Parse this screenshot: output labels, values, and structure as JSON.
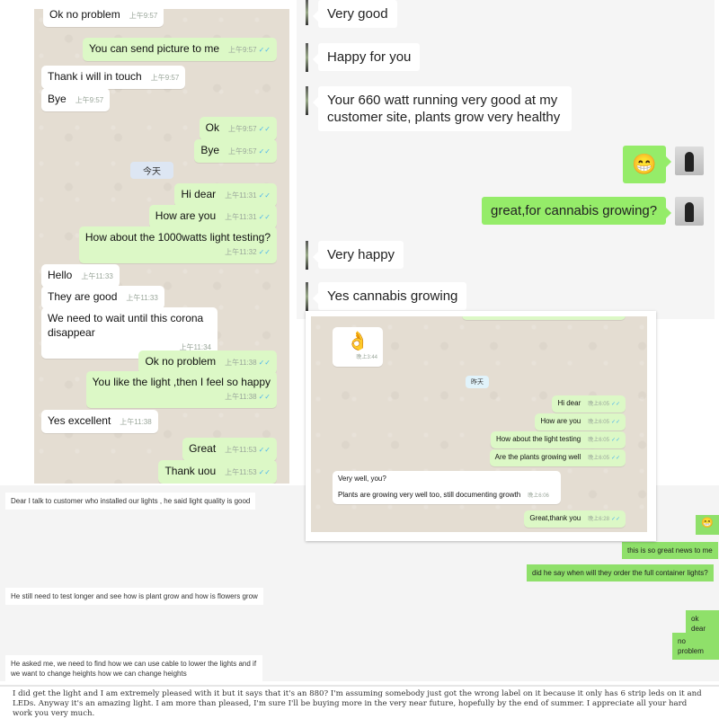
{
  "panel_whatsapp_phone": {
    "messages": [
      {
        "dir": "in",
        "text": "Ok no problem",
        "time": "上午9:57"
      },
      {
        "dir": "out",
        "text": "You can send picture to me",
        "time": "上午9:57"
      },
      {
        "dir": "in",
        "text": "Thank i will in touch",
        "time": "上午9:57"
      },
      {
        "dir": "in",
        "text": "Bye",
        "time": "上午9:57"
      },
      {
        "dir": "out",
        "text": "Ok",
        "time": "上午9:57"
      },
      {
        "dir": "out",
        "text": "Bye",
        "time": "上午9:57"
      },
      {
        "dir": "out",
        "text": "Hi dear",
        "time": "上午11:31"
      },
      {
        "dir": "out",
        "text": "How are you",
        "time": "上午11:31"
      },
      {
        "dir": "out",
        "text": "How about the 1000watts light testing?",
        "time": "上午11:32"
      },
      {
        "dir": "in",
        "text": "Hello",
        "time": "上午11:33"
      },
      {
        "dir": "in",
        "text": "They are good",
        "time": "上午11:33"
      },
      {
        "dir": "in",
        "text": "We need to wait until this corona disappear",
        "time": "上午11:34"
      },
      {
        "dir": "out",
        "text": "Ok no problem",
        "time": "上午11:38"
      },
      {
        "dir": "out",
        "text": "You like the light ,then I feel so happy",
        "time": "上午11:38"
      },
      {
        "dir": "in",
        "text": "Yes excellent",
        "time": "上午11:38"
      },
      {
        "dir": "out",
        "text": "Great",
        "time": "上午11:53"
      },
      {
        "dir": "out",
        "text": "Thank uou",
        "time": "上午11:53"
      }
    ],
    "day_separator": "今天",
    "tick_icon": "✓✓"
  },
  "panel_wechat": {
    "messages": [
      {
        "dir": "in",
        "text": "Very good"
      },
      {
        "dir": "in",
        "text": "Happy for you"
      },
      {
        "dir": "in",
        "text": "Your 660 watt running very good at my customer site, plants grow very healthy"
      },
      {
        "dir": "out",
        "text": "😁",
        "type": "emoji"
      },
      {
        "dir": "out",
        "text": "great,for cannabis growing?"
      },
      {
        "dir": "in",
        "text": "Very happy"
      },
      {
        "dir": "in",
        "text": "Yes cannabis growing"
      }
    ]
  },
  "panel_whatsapp_desktop": {
    "sticker": {
      "emoji": "👌",
      "time": "晚上3:44"
    },
    "day_separator": "昨天",
    "messages": [
      {
        "dir": "out",
        "text": "Hi dear",
        "time": "晚上6:05"
      },
      {
        "dir": "out",
        "text": "How are you",
        "time": "晚上6:05"
      },
      {
        "dir": "out",
        "text": "How about the light testing",
        "time": "晚上6:05"
      },
      {
        "dir": "out",
        "text": "Are the plants growing well",
        "time": "晚上6:05"
      },
      {
        "dir": "in",
        "text_line1": "Very well, you?",
        "text_line2": "Plants are growing very well too, still documenting growth",
        "time": "晚上6:06"
      },
      {
        "dir": "out",
        "text": "Great,thank you",
        "time": "晚上6:28"
      }
    ]
  },
  "panel_web_chat": {
    "messages": [
      {
        "dir": "in",
        "text": "Dear I talk to customer who installed our lights , he said light quality is good"
      },
      {
        "dir": "out",
        "text": "😁",
        "type": "emoji"
      },
      {
        "dir": "out",
        "text": "this is so great news to me"
      },
      {
        "dir": "out",
        "text": "did he say when will they order the full container lights?"
      },
      {
        "dir": "in",
        "text": "He still need to test longer and see how is plant grow and how is flowers grow"
      },
      {
        "dir": "out",
        "text": "ok dear"
      },
      {
        "dir": "out",
        "text": "no problem"
      },
      {
        "dir": "in",
        "text": "He asked me, we need to find how we can use cable to lower the lights and if we want to change heights how we can change heights"
      }
    ]
  },
  "review": {
    "text": "I did get the light and I am extremely pleased with it but it says that it's an 880? I'm assuming somebody just got the wrong label on it because it only has 6 strip leds on it and LEDs. Anyway it's an amazing light. I am more than pleased, I'm sure I'll be buying more in the very near future, hopefully by the end of summer. I appreciate all your hard work you very much."
  }
}
